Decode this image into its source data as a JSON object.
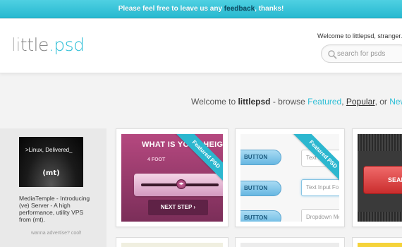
{
  "notice": {
    "before": "Please feel free to leave us any ",
    "link": "feedback",
    "after": ", thanks!"
  },
  "header": {
    "logo_part1": "li",
    "logo_part2": "ttle",
    "logo_part3": ".psd",
    "welcome": "Welcome to littlepsd, stranger.",
    "search_placeholder": "search for psds"
  },
  "tagline": {
    "prefix": "Welcome to ",
    "brand": "littlepsd",
    "mid": " - browse ",
    "featured": "Featured",
    "comma": ", ",
    "popular": "Popular",
    "or": ", or ",
    "newest": "Newest"
  },
  "ad": {
    "image_line1": ">Linux, Delivered_",
    "image_line2": "(mt)",
    "text": "MediaTemple - Introducing (ve) Server - A high performance, utility VPS from (mt).",
    "cta": "wanna advertise? cool!"
  },
  "cards": [
    {
      "ribbon": "Featured PSD",
      "title": "WHAT IS YOUR HEIGHT",
      "sub": "4 FOOT",
      "knob": "◂▸",
      "button": "NEXT STEP ›"
    },
    {
      "ribbon": "Featured PSD",
      "buttons": [
        "BUTTON",
        "BUTTON",
        "BUTTON"
      ],
      "inputs": [
        "Text Input",
        "Text Input Fo",
        "Dropdown Me"
      ]
    },
    {
      "button": "SEAR"
    }
  ],
  "colors": {
    "accent": "#2cbed6",
    "notice_bg": "#27b9d0",
    "card1_bg": "#9a3c6d",
    "card3_button": "#d83c3c"
  }
}
